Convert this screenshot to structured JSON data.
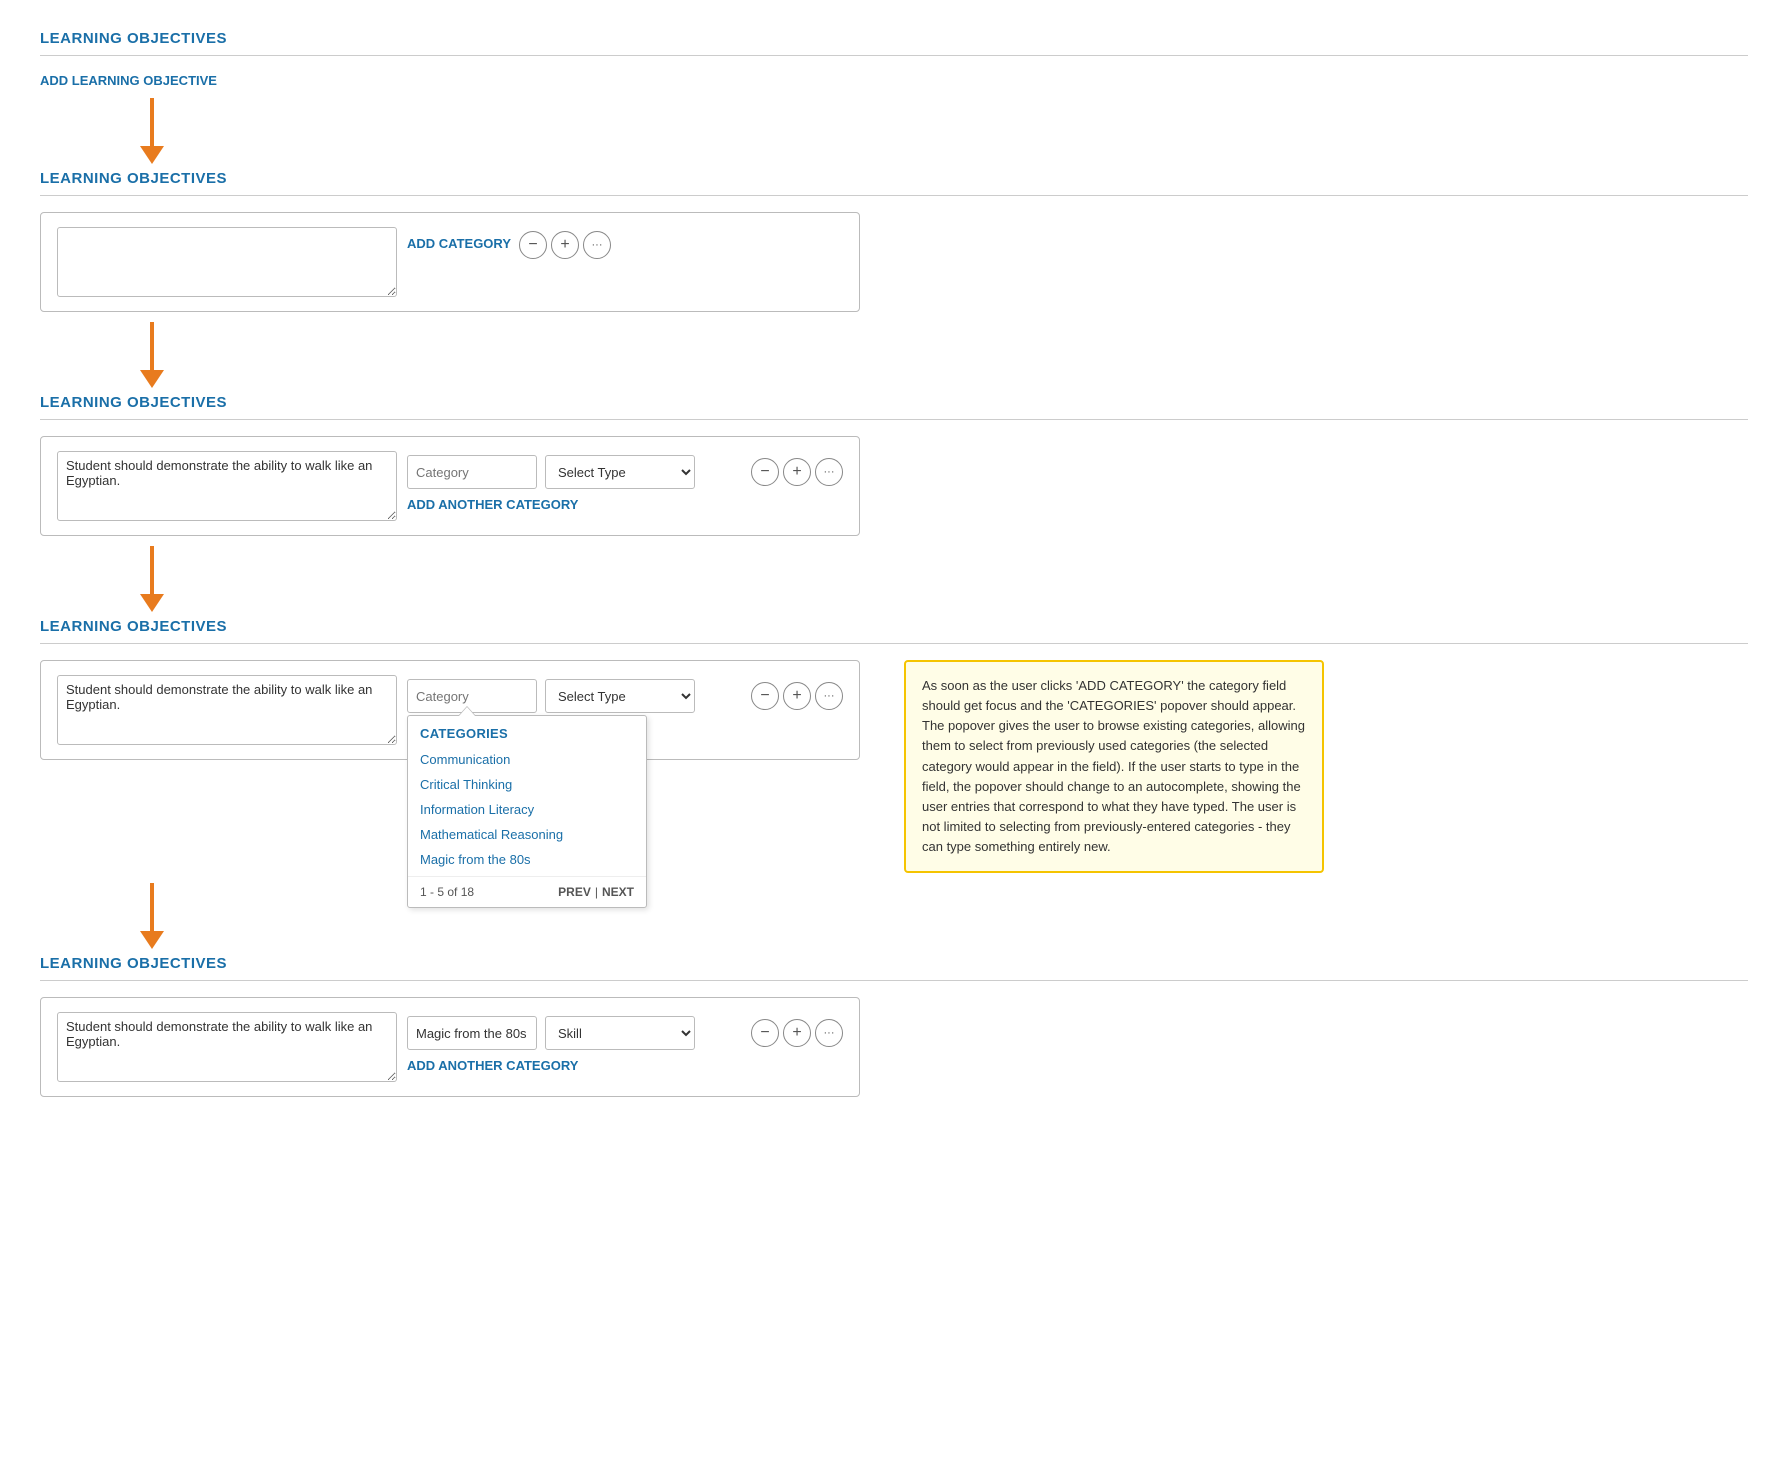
{
  "sections": {
    "s1_title": "LEARNING OBJECTIVES",
    "s1_add_link": "ADD LEARNING OBJECTIVE",
    "s2_title": "LEARNING OBJECTIVES",
    "s2_card": {
      "textarea_placeholder": "",
      "add_category_link": "ADD CATEGORY",
      "action_minus": "−",
      "action_plus": "+",
      "action_more": "•••"
    },
    "s3_title": "LEARNING OBJECTIVES",
    "s3_card": {
      "textarea_value": "Student should demonstrate the ability to walk like an Egyptian.",
      "category_placeholder": "Category",
      "select_type_label": "Select Type",
      "add_another_link": "ADD ANOTHER CATEGORY"
    },
    "s4_title": "LEARNING OBJECTIVES",
    "s4_card": {
      "textarea_value": "Student should demonstrate the ability to walk like an Egyptian.",
      "category_placeholder": "Category",
      "select_type_label": "Select Type",
      "popover": {
        "header": "CATEGORIES",
        "items": [
          "Communication",
          "Critical Thinking",
          "Information Literacy",
          "Mathematical Reasoning",
          "Magic from the 80s"
        ],
        "pagination": "1 - 5 of 18",
        "prev_label": "PREV",
        "next_label": "NEXT",
        "separator": "|"
      }
    },
    "s4_annotation": "As soon as the user clicks 'ADD CATEGORY' the category field should get focus and the 'CATEGORIES' popover should appear. The popover gives the user to browse existing categories, allowing them to select from previously used categories (the selected category would appear in the field). If the user starts to type in the field, the popover should change to an autocomplete, showing the user entries that correspond to what they have typed. The user is not limited to selecting from previously-entered categories - they can type something entirely new.",
    "s5_title": "LEARNING OBJECTIVES",
    "s5_card": {
      "textarea_value": "Student should demonstrate the ability to walk like an Egyptian.",
      "category_value": "Magic from the 80s",
      "select_type_value": "Skill",
      "add_another_link": "ADD ANOTHER CATEGORY"
    }
  },
  "icons": {
    "minus": "−",
    "plus": "+",
    "more": "···"
  }
}
